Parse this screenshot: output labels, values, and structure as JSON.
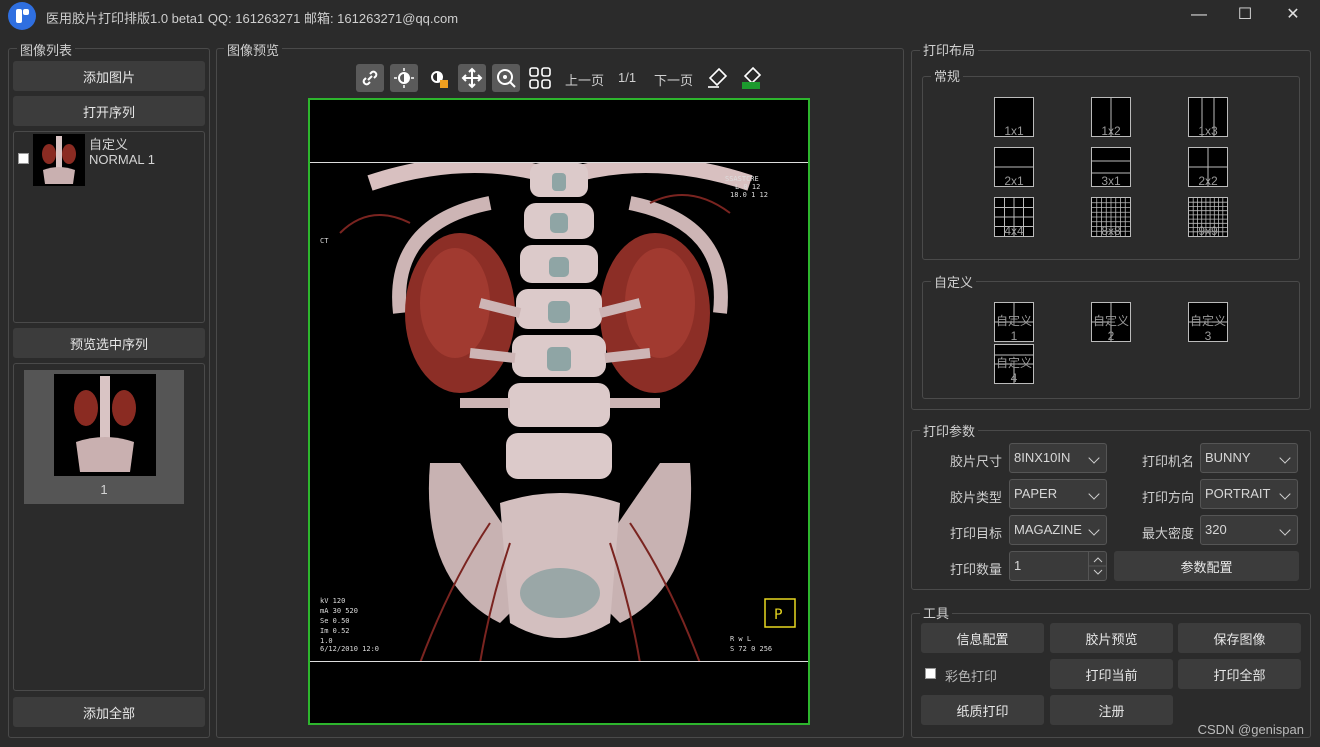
{
  "window": {
    "title": "医用胶片打印排版1.0 beta1 QQ: 161263271 邮箱: 161263271@qq.com",
    "minimize": "—",
    "maximize": "☐",
    "close": "✕"
  },
  "image_list": {
    "title": "图像列表",
    "add_image": "添加图片",
    "open_series": "打开序列",
    "series_items": [
      {
        "name": "自定义",
        "sub": "NORMAL 1",
        "checked": false
      }
    ],
    "preview_selected": "预览选中序列",
    "thumbnail_caption": "1",
    "add_all": "添加全部"
  },
  "preview": {
    "title": "图像预览",
    "toolbar": [
      {
        "icon": "link-icon"
      },
      {
        "icon": "brightness-icon"
      },
      {
        "icon": "window-level-icon"
      },
      {
        "icon": "pan-icon"
      },
      {
        "icon": "zoom-icon"
      },
      {
        "icon": "grid-icon"
      }
    ],
    "prev_page": "上一页",
    "page_indicator": "1/1",
    "next_page": "下一页",
    "clear_icon": "eraser-icon",
    "clear_all_icon": "eraser-all-icon"
  },
  "print_layout": {
    "title": "打印布局",
    "regular": {
      "title": "常规",
      "layouts": [
        "1x1",
        "1x2",
        "1x3",
        "2x1",
        "3x1",
        "2x2",
        "4x4",
        "8x8",
        "9x9"
      ]
    },
    "custom": {
      "title": "自定义",
      "layouts": [
        "自定义1",
        "自定义2",
        "自定义3",
        "自定义4"
      ]
    }
  },
  "print_params": {
    "title": "打印参数",
    "film_size_label": "胶片尺寸",
    "film_size": "8INX10IN",
    "printer_label": "打印机名",
    "printer": "BUNNY",
    "film_type_label": "胶片类型",
    "film_type": "PAPER",
    "orientation_label": "打印方向",
    "orientation": "PORTRAIT",
    "target_label": "打印目标",
    "target": "MAGAZINE",
    "max_density_label": "最大密度",
    "max_density": "320",
    "copies_label": "打印数量",
    "copies": "1",
    "config_button": "参数配置"
  },
  "tools": {
    "title": "工具",
    "info_config": "信息配置",
    "film_preview": "胶片预览",
    "save_image": "保存图像",
    "color_print_label": "彩色打印",
    "print_current": "打印当前",
    "print_all": "打印全部",
    "paper_print": "纸质打印",
    "register": "注册"
  },
  "watermark": "CSDN @genispan",
  "colors": {
    "background": "#2b2b2b",
    "button": "#3c3c3c",
    "preview_border": "#2db52d",
    "accent_blue": "#2f6fe0"
  }
}
